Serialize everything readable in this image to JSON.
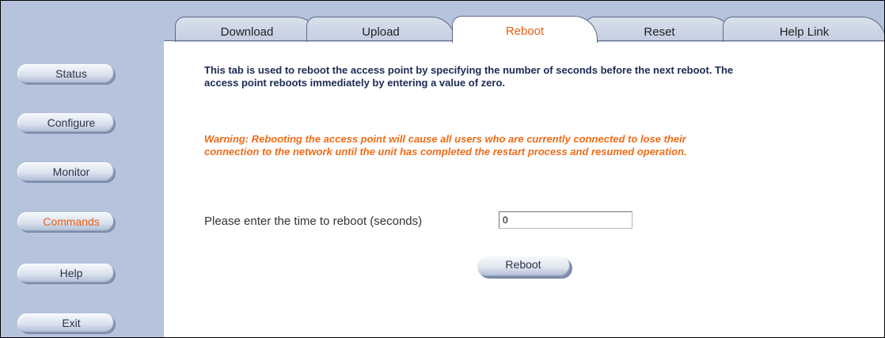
{
  "tabs": [
    {
      "label": "Download"
    },
    {
      "label": "Upload"
    },
    {
      "label": "Reboot",
      "active": true
    },
    {
      "label": "Reset"
    },
    {
      "label": "Help Link"
    }
  ],
  "sidebar": {
    "items": [
      {
        "label": "Status"
      },
      {
        "label": "Configure"
      },
      {
        "label": "Monitor"
      },
      {
        "label": "Commands",
        "active": true
      },
      {
        "label": "Help"
      },
      {
        "label": "Exit"
      }
    ]
  },
  "main": {
    "description": "This tab is used to reboot the access point by specifying the number of seconds before the next reboot. The access point reboots immediately by entering a value of zero.",
    "warning": "Warning: Rebooting the access point will cause all users who are currently connected to lose their connection to the network until the unit has completed the restart process and resumed operation.",
    "reboot_time_label": "Please enter the time to reboot (seconds)",
    "reboot_time_value": "0",
    "reboot_button_label": "Reboot"
  },
  "colors": {
    "sidebar_bg": "#b5c3dd",
    "active_accent": "#e85d12",
    "description_text": "#1c2a55",
    "warning_text": "#f06b18"
  }
}
